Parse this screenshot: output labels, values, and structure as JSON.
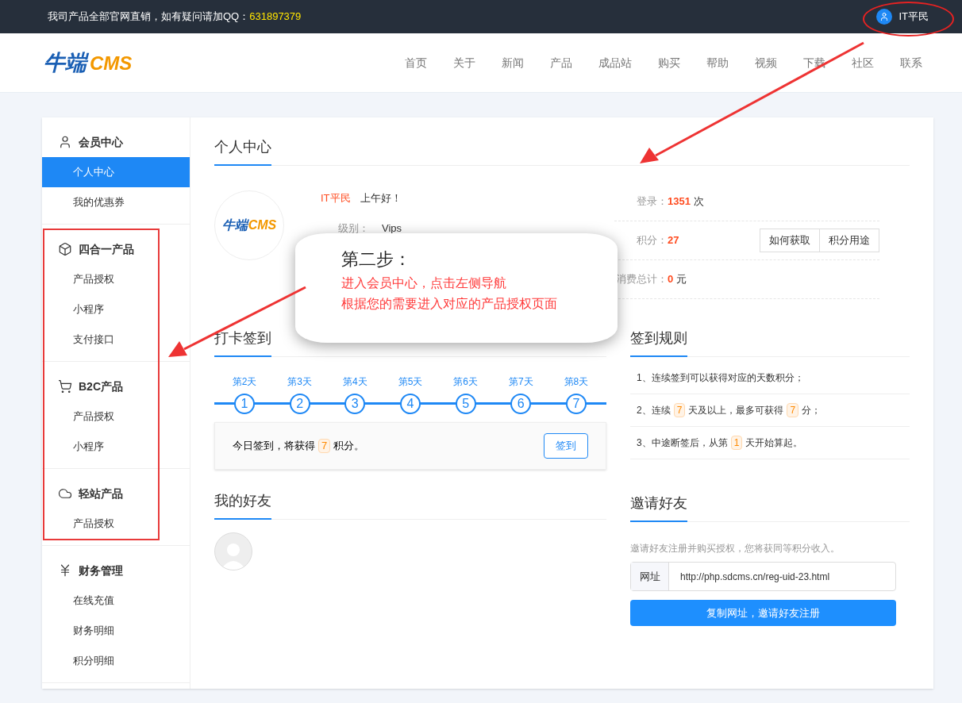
{
  "topbar": {
    "notice": "我司产品全部官网直销，如有疑问请加QQ：",
    "qq": "631897379",
    "user": "IT平民"
  },
  "header": {
    "logo_main": "牛端",
    "logo_sub": "CMS",
    "nav": [
      {
        "label": "首页",
        "selected": false
      },
      {
        "label": "关于",
        "selected": false
      },
      {
        "label": "新闻",
        "selected": false
      },
      {
        "label": "产品",
        "selected": false
      },
      {
        "label": "成品站",
        "selected": false
      },
      {
        "label": "购买",
        "selected": false
      },
      {
        "label": "帮助",
        "selected": false
      },
      {
        "label": "视频",
        "selected": false
      },
      {
        "label": "下载",
        "selected": false
      },
      {
        "label": "社区",
        "selected": false
      },
      {
        "label": "联系",
        "selected": false
      }
    ]
  },
  "sidebar": [
    {
      "title": "会员中心",
      "kind": "user",
      "items": [
        {
          "label": "个人中心",
          "selected": true
        },
        {
          "label": "我的优惠券",
          "selected": false
        }
      ]
    },
    {
      "title": "四合一产品",
      "kind": "box",
      "items": [
        {
          "label": "产品授权",
          "selected": false
        },
        {
          "label": "小程序",
          "selected": false
        },
        {
          "label": "支付接口",
          "selected": false
        }
      ]
    },
    {
      "title": "B2C产品",
      "kind": "cart",
      "items": [
        {
          "label": "产品授权",
          "selected": false
        },
        {
          "label": "小程序",
          "selected": false
        }
      ]
    },
    {
      "title": "轻站产品",
      "kind": "cloud",
      "items": [
        {
          "label": "产品授权",
          "selected": false
        }
      ]
    },
    {
      "title": "财务管理",
      "kind": "yen",
      "items": [
        {
          "label": "在线充值",
          "selected": false
        },
        {
          "label": "财务明细",
          "selected": false
        },
        {
          "label": "积分明细",
          "selected": false
        }
      ]
    }
  ],
  "profile": {
    "title": "个人中心",
    "avatar_main": "牛端",
    "avatar_sub": "CMS",
    "name": "IT平民",
    "greeting": "上午好！",
    "level_label": "级别：",
    "level": "Vips",
    "stats": [
      {
        "label": "登录：",
        "value": "1351",
        "unit": "次"
      },
      {
        "label": "积分：",
        "value": "27",
        "buttons": [
          "如何获取",
          "积分用途"
        ]
      },
      {
        "label": "消费总计：",
        "value": "0",
        "unit": "元"
      }
    ]
  },
  "checkin": {
    "title": "打卡签到",
    "days": [
      {
        "label": "第2天",
        "number": "1"
      },
      {
        "label": "第3天",
        "number": "2"
      },
      {
        "label": "第4天",
        "number": "3"
      },
      {
        "label": "第5天",
        "number": "4"
      },
      {
        "label": "第6天",
        "number": "5"
      },
      {
        "label": "第7天",
        "number": "6"
      },
      {
        "label": "第8天",
        "number": "7"
      }
    ],
    "notice": [
      {
        "kind": "plain",
        "text": "今日签到，将获得"
      },
      {
        "kind": "highlight",
        "text": "7"
      },
      {
        "kind": "plain",
        "text": "积分。"
      }
    ],
    "button": "签到"
  },
  "rules": {
    "title": "签到规则",
    "items": [
      [
        {
          "kind": "plain",
          "text": "1、连续签到可以获得对应的天数积分；"
        }
      ],
      [
        {
          "kind": "plain",
          "text": "2、连续"
        },
        {
          "kind": "highlight",
          "text": "7"
        },
        {
          "kind": "plain",
          "text": "天及以上，最多可获得"
        },
        {
          "kind": "highlight",
          "text": "7"
        },
        {
          "kind": "plain",
          "text": "分；"
        }
      ],
      [
        {
          "kind": "plain",
          "text": "3、中途断签后，从第"
        },
        {
          "kind": "highlight",
          "text": "1"
        },
        {
          "kind": "plain",
          "text": "天开始算起。"
        }
      ]
    ]
  },
  "friends": {
    "title": "我的好友"
  },
  "invite": {
    "title": "邀请好友",
    "description": "邀请好友注册并购买授权，您将获同等积分收入。",
    "url_label": "网址",
    "url": "http://php.sdcms.cn/reg-uid-23.html",
    "button": "复制网址，邀请好友注册"
  },
  "callout": {
    "title": "第二步：",
    "lines": [
      "进入会员中心，点击左侧导航",
      "根据您的需要进入对应的产品授权页面"
    ]
  }
}
